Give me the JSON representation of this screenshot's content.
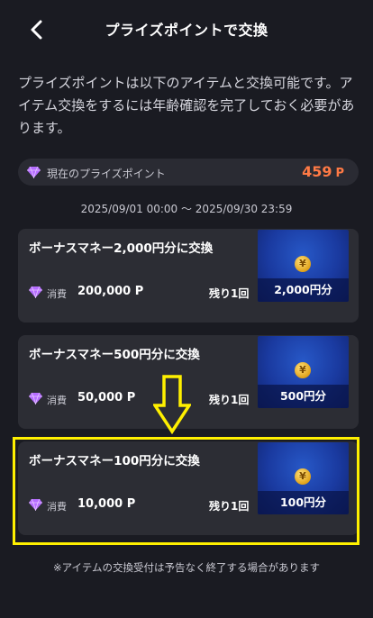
{
  "header": {
    "title": "プライズポイントで交換"
  },
  "intro": {
    "text": "プライズポイントは以下のアイテムと交換可能です。アイテム交換をするには年齢確認を完了しておく必要があります。"
  },
  "points": {
    "label": "現在のプライズポイント",
    "value": "459",
    "unit": "P"
  },
  "period": "2025/09/01 00:00 〜 2025/09/30 23:59",
  "items": [
    {
      "title": "ボーナスマネー2,000円分に交換",
      "cost_label": "消費",
      "cost": "200,000 P",
      "remaining": "残り1回",
      "thumb_label": "2,000円分",
      "coin_symbol": "¥"
    },
    {
      "title": "ボーナスマネー500円分に交換",
      "cost_label": "消費",
      "cost": "50,000 P",
      "remaining": "残り1回",
      "thumb_label": "500円分",
      "coin_symbol": "¥"
    },
    {
      "title": "ボーナスマネー100円分に交換",
      "cost_label": "消費",
      "cost": "10,000 P",
      "remaining": "残り1回",
      "thumb_label": "100円分",
      "coin_symbol": "¥"
    }
  ],
  "footnote": "※アイテムの交換受付は予告なく終了する場合があります",
  "colors": {
    "background": "#1a1b22",
    "card": "#2c2d34",
    "points_accent": "#ff7a45",
    "gem": "#b56cff",
    "highlight": "#fff000"
  }
}
